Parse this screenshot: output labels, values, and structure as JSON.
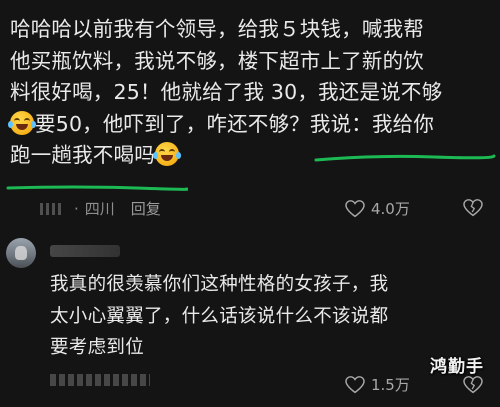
{
  "comment1": {
    "lines": [
      "哈哈哈以前我有个领导，给我５块钱，喊我帮",
      "他买瓶饮料，我说不够，楼下超市上了新的饮",
      "料很好喝，25！他就给了我 30，我还是说不够",
      "要50，他吓到了，咋还不够？我说：我给你",
      "跑一趟我不喝吗"
    ],
    "location": "四川",
    "reply_label": "回复",
    "likes": "4.0万"
  },
  "comment2": {
    "lines": [
      "我真的很羡慕你们这种性格的女孩子，我",
      "太小心翼翼了，什么话该说什么不该说都",
      "要考虑到位"
    ],
    "likes": "1.5万"
  },
  "emoji_icon": "laughing-crying-emoji",
  "underline_color": "#1db954",
  "watermark": "鸿勤手"
}
